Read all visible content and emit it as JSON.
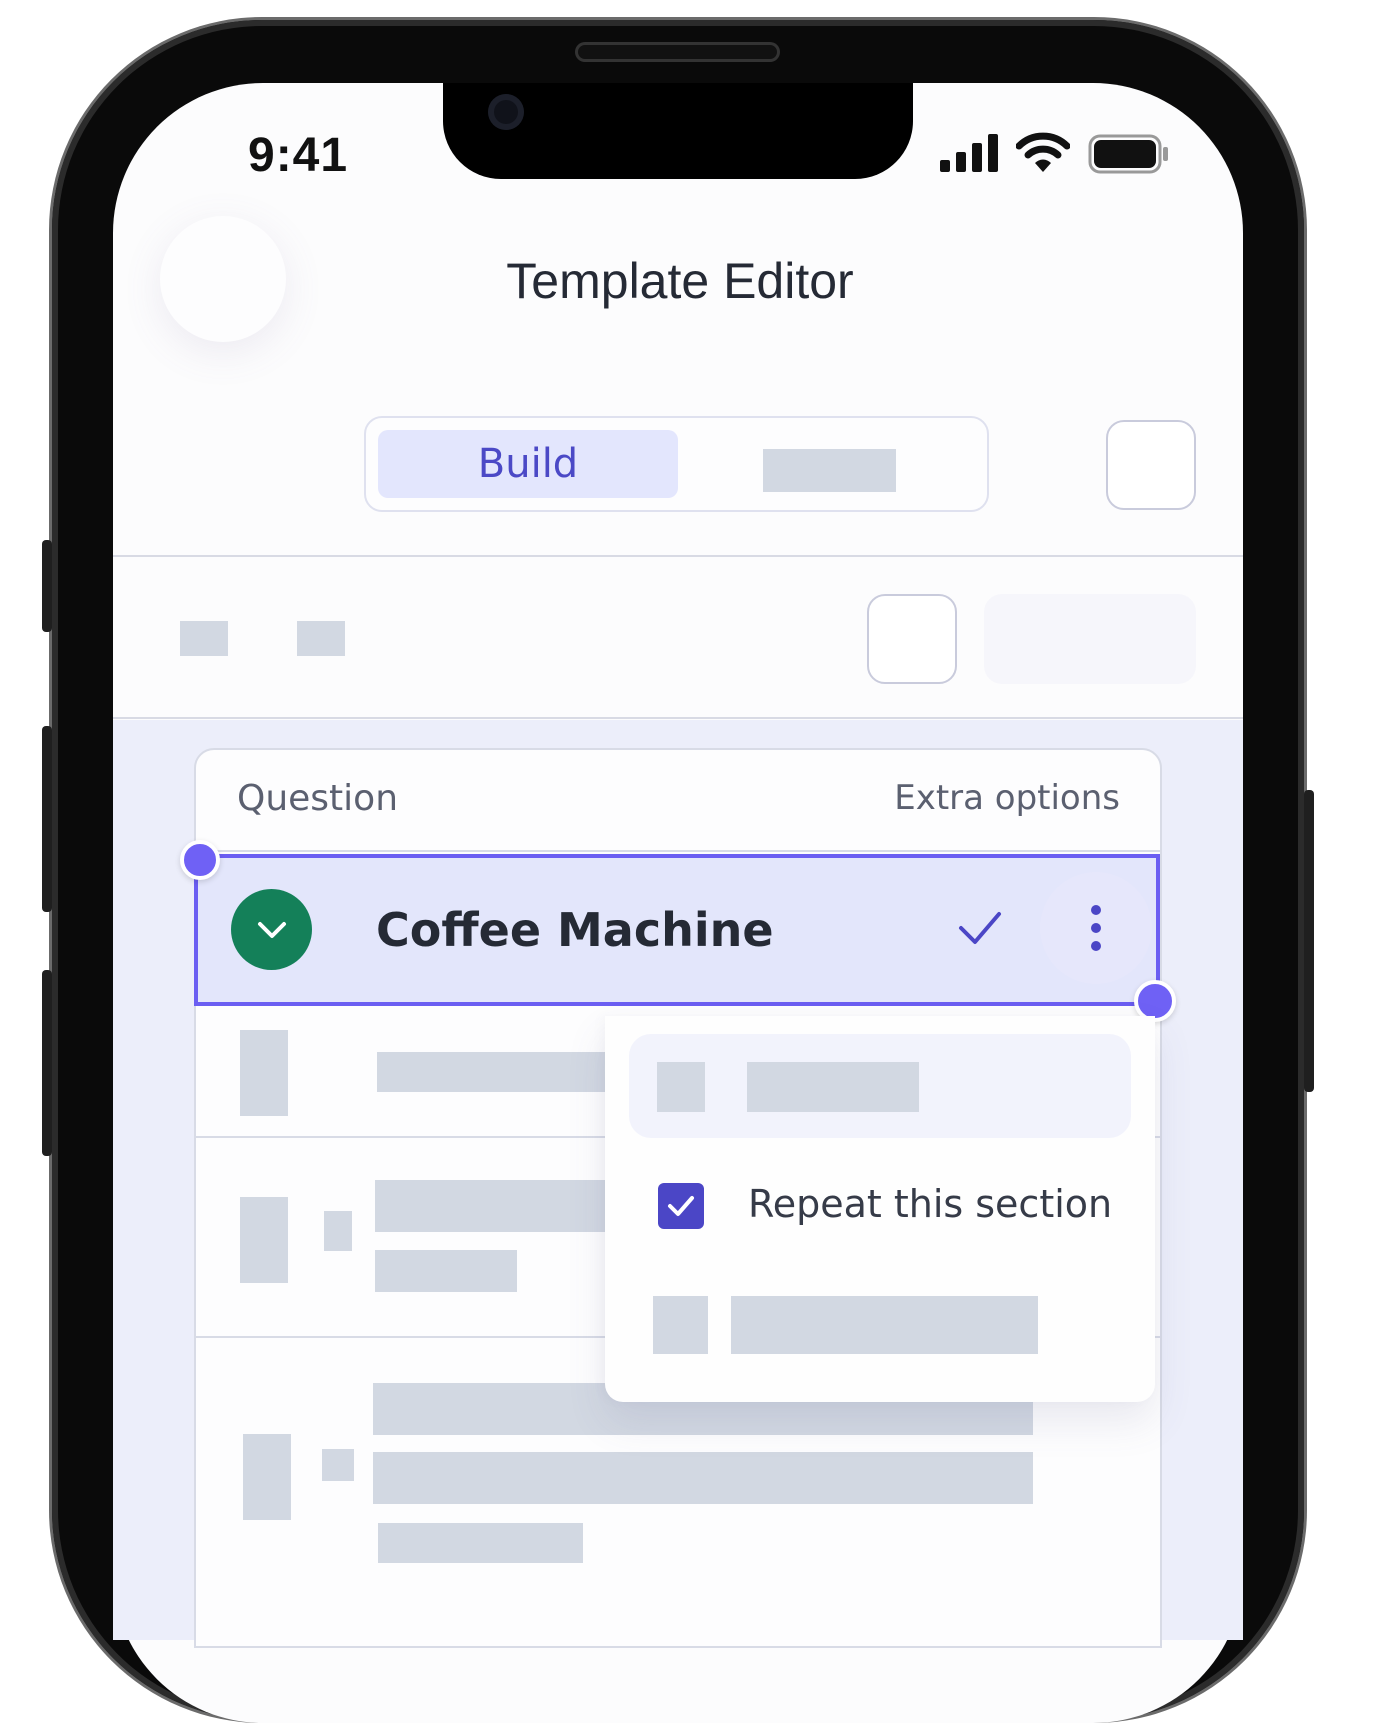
{
  "status_bar": {
    "time": "9:41",
    "icons": [
      "signal-icon",
      "wifi-icon",
      "battery-icon"
    ]
  },
  "header": {
    "title": "Template Editor",
    "back_icon": "back-icon"
  },
  "segmented_control": {
    "active_label": "Build",
    "other_label": ""
  },
  "table": {
    "column_question": "Question",
    "column_extra": "Extra options",
    "selected_row": {
      "title": "Coffee Machine",
      "status_icon": "checkmark-icon",
      "expand_icon": "chevron-down-icon",
      "more_icon": "more-vertical-icon"
    }
  },
  "context_menu": {
    "repeat_label": "Repeat this section",
    "repeat_checked": true
  },
  "colors": {
    "accent": "#6b5ef2",
    "primary": "#4b46c6",
    "success": "#148059",
    "skeleton": "#d2d8e2",
    "selection_bg": "#e3e6fb"
  }
}
